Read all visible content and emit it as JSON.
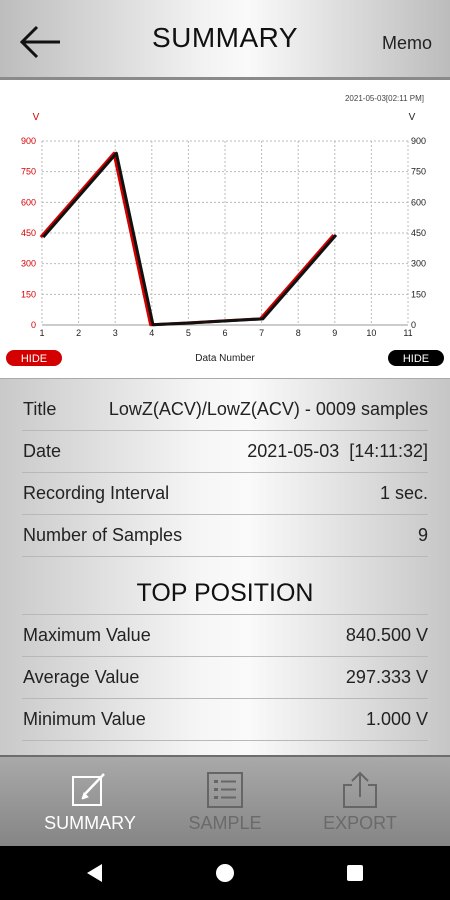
{
  "header": {
    "back_icon": "arrow-left-icon",
    "title": "SUMMARY",
    "memo_label": "Memo"
  },
  "chart": {
    "timestamp": "2021-05-03[02:11 PM]",
    "left_unit": "V",
    "right_unit": "V",
    "xlabel": "Data Number",
    "hide_left_label": "HIDE",
    "hide_right_label": "HIDE"
  },
  "chart_data": {
    "type": "line",
    "x": [
      1,
      2,
      3,
      4,
      5,
      6,
      7,
      8,
      9
    ],
    "xlim": [
      1,
      11
    ],
    "xticks": [
      "1",
      "2",
      "3",
      "4",
      "5",
      "6",
      "7",
      "8",
      "9",
      "10",
      "11"
    ],
    "ylim": [
      0,
      900
    ],
    "yticks": [
      "0",
      "150",
      "300",
      "450",
      "600",
      "750",
      "900"
    ],
    "xlabel": "Data Number",
    "ylabel_left": "V",
    "ylabel_right": "V",
    "grid": true,
    "series": [
      {
        "axis": "left",
        "color": "#d40000",
        "values": [
          430,
          635,
          840,
          1,
          10,
          20,
          30,
          235,
          440
        ]
      },
      {
        "axis": "right",
        "color": "#111111",
        "values": [
          430,
          635,
          840,
          1,
          10,
          20,
          30,
          235,
          440
        ]
      }
    ]
  },
  "info": {
    "title_label": "Title",
    "title_value": "LowZ(ACV)/LowZ(ACV) - 0009 samples",
    "date_label": "Date",
    "date_value": "2021-05-03  [14:11:32]",
    "interval_label": "Recording Interval",
    "interval_value": "1 sec.",
    "samples_label": "Number of Samples",
    "samples_value": "9",
    "section_title": "TOP POSITION",
    "max_label": "Maximum Value",
    "max_value": "840.500 V",
    "avg_label": "Average Value",
    "avg_value": "297.333 V",
    "min_label": "Minimum Value",
    "min_value": "1.000 V"
  },
  "bottom_nav": {
    "summary_label": "SUMMARY",
    "summary_icon": "edit-note-icon",
    "sample_label": "SAMPLE",
    "sample_icon": "list-icon",
    "export_label": "EXPORT",
    "export_icon": "share-icon",
    "active_color": "#ffffff",
    "inactive_color": "#6a6a6a"
  },
  "android_nav": {
    "back_icon": "triangle-back-icon",
    "home_icon": "circle-home-icon",
    "recents_icon": "square-recents-icon"
  }
}
